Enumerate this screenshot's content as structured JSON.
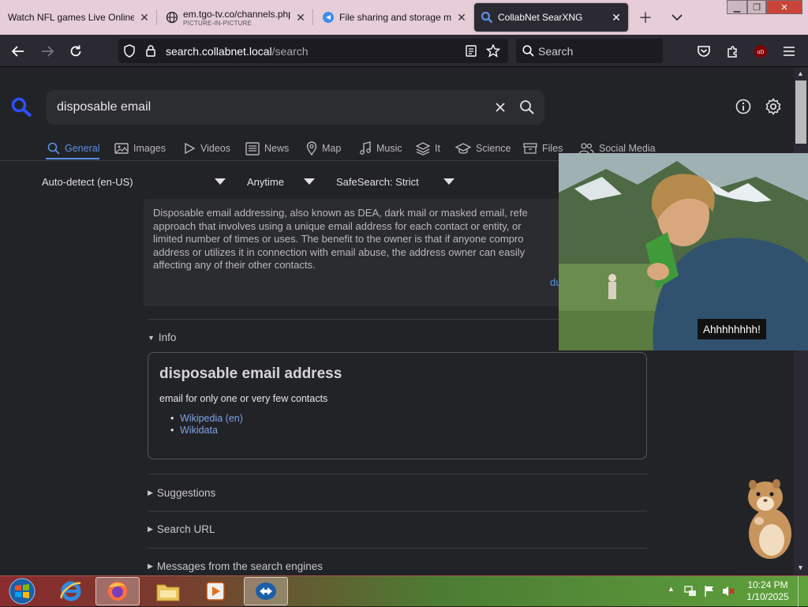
{
  "browser": {
    "tabs": [
      {
        "title": "Watch NFL games Live Online"
      },
      {
        "title": "em.tgo-tv.co/channels.php",
        "subtitle": "PICTURE-IN-PICTURE"
      },
      {
        "title": "File sharing and storage m"
      },
      {
        "title": "CollabNet SearXNG"
      }
    ],
    "url_host": "search.collabnet.local",
    "url_path": "/search",
    "search_placeholder": "Search",
    "addon_badge": "uD",
    "window_controls": {
      "minimize": "▁",
      "maximize": "❐",
      "close": "✕"
    }
  },
  "page": {
    "query": "disposable email",
    "categories": [
      {
        "label": "General",
        "icon": "search-icon",
        "active": true
      },
      {
        "label": "Images",
        "icon": "image-icon"
      },
      {
        "label": "Videos",
        "icon": "play-icon"
      },
      {
        "label": "News",
        "icon": "newspaper-icon"
      },
      {
        "label": "Map",
        "icon": "map-pin-icon"
      },
      {
        "label": "Music",
        "icon": "music-note-icon"
      },
      {
        "label": "It",
        "icon": "layers-icon"
      },
      {
        "label": "Science",
        "icon": "graduation-cap-icon"
      },
      {
        "label": "Files",
        "icon": "archive-icon"
      },
      {
        "label": "Social Media",
        "icon": "people-icon"
      }
    ],
    "filters": {
      "language": "Auto-detect (en-US)",
      "time": "Anytime",
      "safesearch": "SafeSearch: Strict"
    },
    "infobox_text": "Disposable email addressing, also known as DEA, dark mail or masked email, refe\napproach that involves using a unique email address for each contact or entity, or\nlimited number of times or uses. The benefit to the owner is that if anyone compro\naddress or utilizes it in connection with email abuse, the address owner can easily\naffecting any of their other contacts.",
    "infobox_more": "du",
    "info_label": "Info",
    "info_card": {
      "title": "disposable email address",
      "description": "email for only one or very few contacts",
      "links": [
        "Wikipedia (en)",
        "Wikidata"
      ]
    },
    "sections": [
      "Suggestions",
      "Search URL",
      "Messages from the search engines"
    ]
  },
  "pip": {
    "caption": "Ahhhhhhhh!"
  },
  "taskbar": {
    "apps": [
      "windows-start-icon",
      "internet-explorer-icon",
      "firefox-icon",
      "file-explorer-icon",
      "media-player-icon",
      "teamviewer-icon"
    ],
    "clock_time": "10:24 PM",
    "clock_date": "1/10/2025"
  },
  "colors": {
    "accent": "#5c8fe6",
    "page_bg": "#222327",
    "toolbar_bg": "#2b2a33",
    "tabstrip_bg": "#e6cdd8"
  }
}
